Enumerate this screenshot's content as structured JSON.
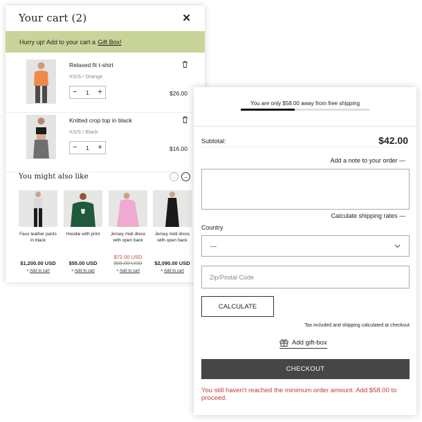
{
  "cart": {
    "title": "Your cart (2)",
    "close_icon": "close-icon",
    "promo": {
      "text": "Hurry up! Add to your cart a",
      "link": "Gift Box!"
    },
    "items": [
      {
        "name": "Relaxed fit t-shirt",
        "variant": "XS/S / Orange",
        "qty": "1",
        "price": "$26.00",
        "top_color": "#f08a4b",
        "bottom_color": "#4b4b4b"
      },
      {
        "name": "Knitted crop top in black",
        "variant": "XS/S / Black",
        "qty": "1",
        "price": "$16.00",
        "top_color": "#1d1d1d",
        "bottom_color": "#6f6f6f"
      }
    ],
    "qty_minus": "−",
    "qty_plus": "+",
    "recommendations": {
      "title": "You might also like",
      "prev_icon": "←",
      "next_icon": "→",
      "add_plus": "+",
      "items": [
        {
          "name": "Faux leather pants in black",
          "price": "$1,200.00 USD",
          "sale_price": "",
          "old_price": "",
          "add": "Add to cart",
          "top_color": "#d9d9d9",
          "bottom_color": "#1c1c1c"
        },
        {
          "name": "Hoodie with print",
          "price": "$55.00 USD",
          "sale_price": "",
          "old_price": "",
          "add": "Add to cart",
          "top_color": "#1f5a3c",
          "bottom_color": "#1f5a3c"
        },
        {
          "name": "Jersey midi dress with open back",
          "price": "",
          "sale_price": "$72.00 USD",
          "old_price": "$86.00 USD",
          "add": "Add to cart",
          "top_color": "#f0a9cf",
          "bottom_color": "#f0a9cf"
        },
        {
          "name": "Jersey midi dress with open back",
          "price": "$2,090.00 USD",
          "sale_price": "",
          "old_price": "",
          "add": "Add to cart",
          "top_color": "#1a1a1a",
          "bottom_color": "#1a1a1a"
        }
      ]
    }
  },
  "checkout": {
    "shipping_text": "You are only $58.00 away from free shipping",
    "shipping_progress": 0.42,
    "subtotal_label": "Subtotal:",
    "subtotal_value": "$42.00",
    "note_link": "Add a note to your order —",
    "rates_link": "Calculate shipping rates —",
    "country_label": "Country",
    "country_value": "---",
    "zip_placeholder": "Zip/Postal Code",
    "calculate": "CALCULATE",
    "tax_text": "Tax included and shipping calculated at checkout",
    "gift_label": "Add gift-box",
    "checkout_label": "CHECKOUT",
    "min_warning": "You still haven't reached the minimum order amount. Add $58.00 to proceed."
  },
  "colors": {
    "promo_bg": "#c9d49a",
    "checkout_bg": "#464646",
    "error": "#c23a3a"
  }
}
